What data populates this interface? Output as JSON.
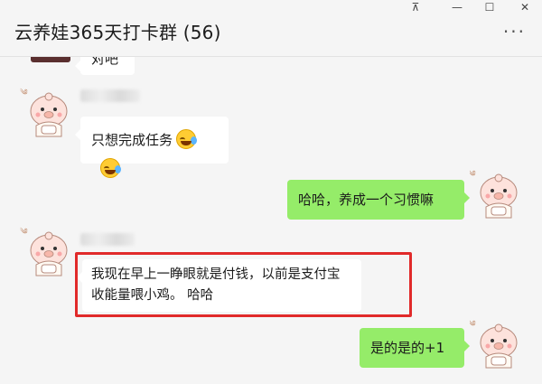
{
  "window": {
    "title": "云养娃365天打卡群 (56)",
    "controls": {
      "pin": "⊼",
      "minimize": "—",
      "maximize": "☐",
      "close": "✕"
    },
    "more": "···"
  },
  "messages": [
    {
      "side": "left",
      "text": "对吧",
      "partial": true
    },
    {
      "side": "left",
      "text": "只想完成任务",
      "emojis": [
        "face-with-tears-of-joy-icon",
        "face-with-tears-of-joy-icon"
      ]
    },
    {
      "side": "right",
      "text": "哈哈，养成一个习惯嘛"
    },
    {
      "side": "left",
      "text": "我现在早上一睁眼就是付钱，以前是支付宝收能量喂小鸡。 哈哈",
      "highlighted": true
    },
    {
      "side": "right",
      "text": "是的是的+1"
    }
  ],
  "colors": {
    "background": "#f5f5f5",
    "outgoing_bubble": "#95ec69",
    "incoming_bubble": "#ffffff",
    "highlight": "#e12a2a"
  }
}
